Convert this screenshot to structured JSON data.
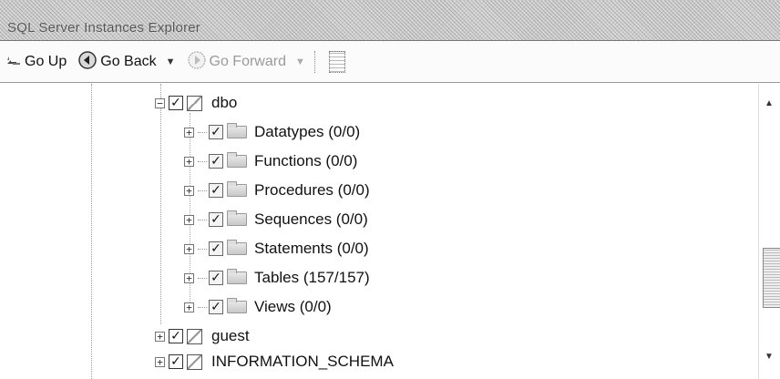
{
  "window": {
    "title": "SQL Server Instances Explorer"
  },
  "toolbar": {
    "go_up_label": "Go Up",
    "go_back_label": "Go Back",
    "go_forward_label": "Go Forward",
    "go_forward_enabled": false
  },
  "tree": {
    "schema": {
      "label": "dbo",
      "expanded": true,
      "checked": true
    },
    "children": [
      {
        "label": "Datatypes (0/0)",
        "checked": true
      },
      {
        "label": "Functions (0/0)",
        "checked": true
      },
      {
        "label": "Procedures (0/0)",
        "checked": true
      },
      {
        "label": "Sequences (0/0)",
        "checked": true
      },
      {
        "label": "Statements (0/0)",
        "checked": true
      },
      {
        "label": "Tables (157/157)",
        "checked": true
      },
      {
        "label": "Views (0/0)",
        "checked": true
      }
    ],
    "siblings": [
      {
        "label": "guest",
        "checked": true
      },
      {
        "label": "INFORMATION_SCHEMA",
        "checked": true
      }
    ]
  },
  "icons": {
    "go_up": "folder-up-icon",
    "go_back": "back-arrow-icon",
    "go_forward": "forward-arrow-icon",
    "properties": "document-icon",
    "schema": "schema-icon",
    "folder": "folder-icon"
  }
}
